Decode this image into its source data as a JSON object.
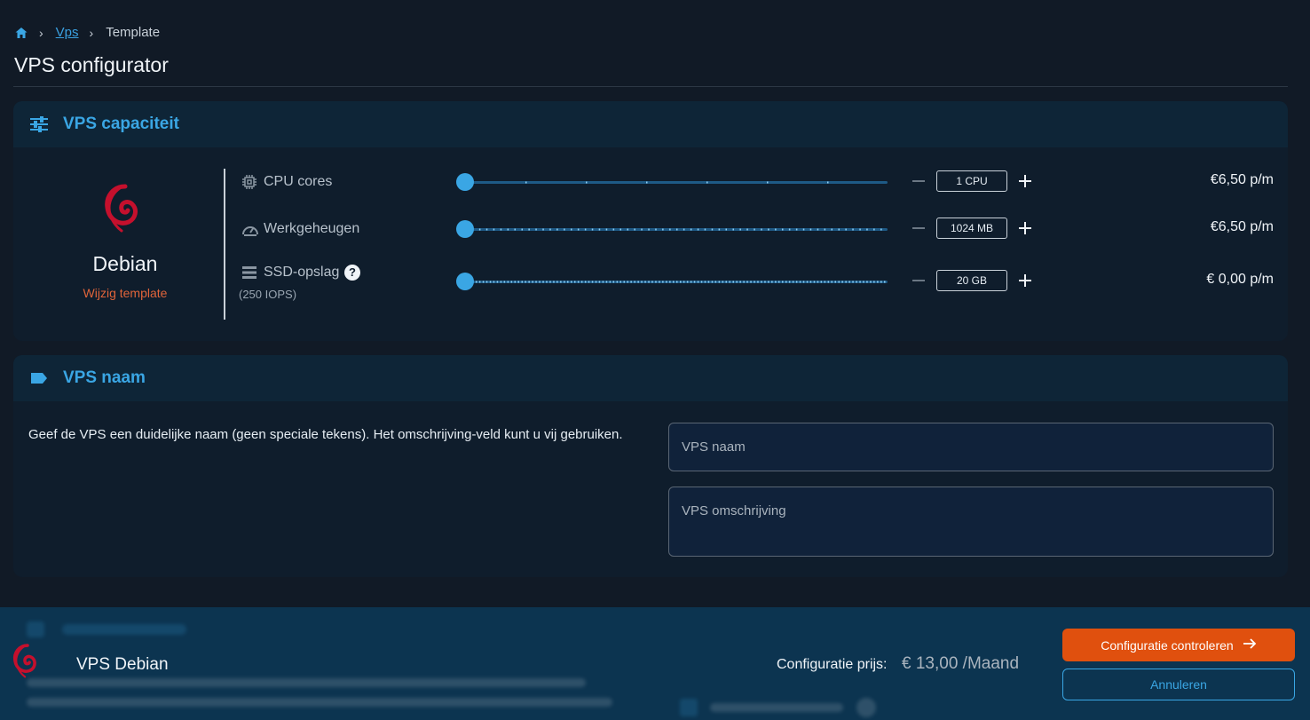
{
  "breadcrumb": {
    "home_icon": "home-icon",
    "link": "Vps",
    "current": "Template"
  },
  "page_title": "VPS configurator",
  "capacity": {
    "title": "VPS capaciteit",
    "icon": "sliders-icon",
    "os": {
      "name": "Debian",
      "change_link": "Wijzig template",
      "logo": "debian-logo"
    },
    "rows": [
      {
        "label": "CPU cores",
        "icon": "cpu-icon",
        "value": "1 CPU",
        "price": "€6,50 p/m",
        "slider_level": 0
      },
      {
        "label": "Werkgeheugen",
        "icon": "gauge-icon",
        "value": "1024 MB",
        "price": "€6,50 p/m",
        "slider_level": 0
      },
      {
        "label": "SSD-opslag",
        "sub": "(250 IOPS)",
        "help": "?",
        "icon": "storage-icon",
        "value": "20 GB",
        "price": "€ 0,00 p/m",
        "slider_level": 0
      }
    ]
  },
  "name_card": {
    "title": "VPS naam",
    "icon": "label-icon",
    "description": "Geef de VPS een duidelijke naam (geen speciale tekens). Het omschrijving-veld kunt u vij gebruiken.",
    "name_placeholder": "VPS naam",
    "desc_placeholder": "VPS omschrijving"
  },
  "footer": {
    "title": "VPS Debian",
    "price_label": "Configuratie prijs:",
    "price": "€ 13,00 /Maand",
    "primary_button": "Configuratie controleren",
    "secondary_button": "Annuleren"
  },
  "colors": {
    "accent": "#3aa6e4",
    "cta": "#e0500e",
    "debian": "#c5102d",
    "link_orange": "#e0643a"
  }
}
